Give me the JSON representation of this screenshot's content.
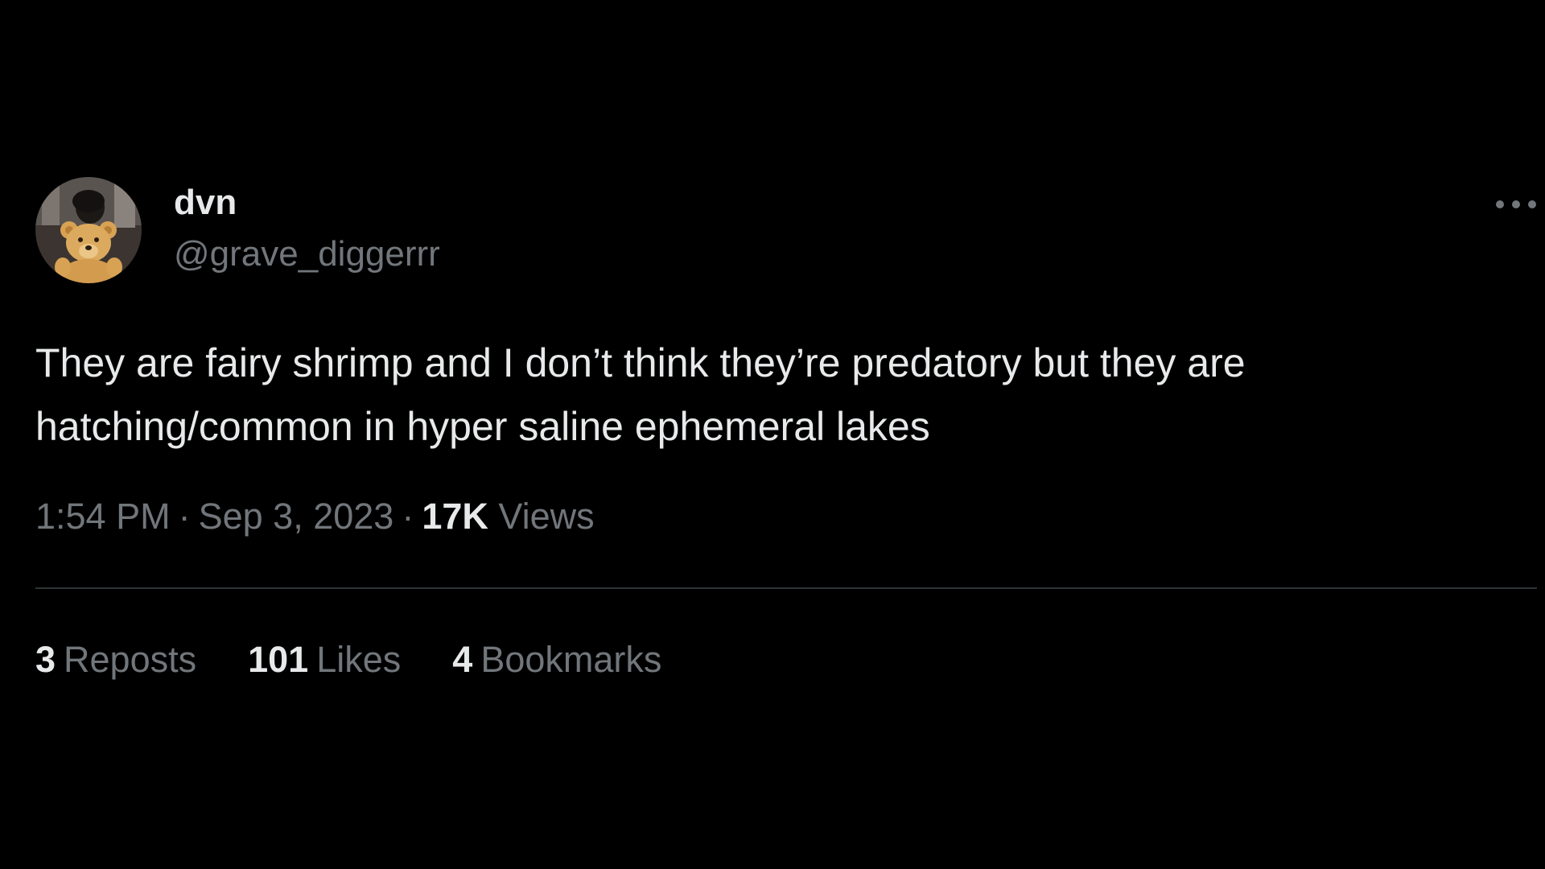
{
  "tweet": {
    "author": {
      "display_name": "dvn",
      "handle": "@grave_diggerrr"
    },
    "text": "They are fairy shrimp and I don’t think they’re predatory but they are hatching/common in hyper saline ephemeral lakes",
    "time": "1:54 PM",
    "separator": "·",
    "date": "Sep 3, 2023",
    "views_count": "17K",
    "views_label": "Views",
    "stats": {
      "reposts_count": "3",
      "reposts_label": "Reposts",
      "likes_count": "101",
      "likes_label": "Likes",
      "bookmarks_count": "4",
      "bookmarks_label": "Bookmarks"
    }
  },
  "icons": {
    "more": "more-horizontal-icon",
    "avatar": "teddy-bear-avatar"
  },
  "colors": {
    "background": "#000000",
    "primary_text": "#e7e9ea",
    "secondary_text": "#71767b",
    "divider": "#2f3336"
  }
}
